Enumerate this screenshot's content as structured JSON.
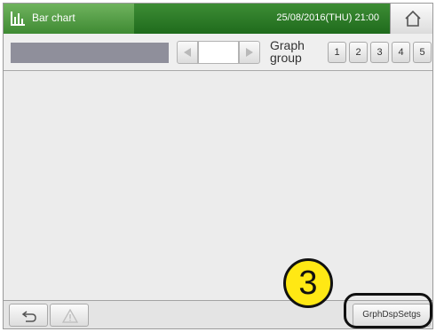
{
  "titlebar": {
    "title": "Bar chart",
    "datetime": "25/08/2016(THU) 21:00",
    "icon": "bar-chart-icon",
    "home_icon": "home-icon"
  },
  "toolbar": {
    "group_value": "",
    "group_label": "Graph group",
    "group_buttons": [
      "1",
      "2",
      "3",
      "4",
      "5"
    ]
  },
  "footer": {
    "back_icon": "back-arrow-icon",
    "warning_icon": "warning-icon",
    "settings_label": "GrphDspSetgs"
  },
  "callout": {
    "number": "3"
  },
  "colors": {
    "title_green": "#2f7d29",
    "callout_yellow": "#ffe814",
    "name_field_gray": "#8f8f9b"
  }
}
